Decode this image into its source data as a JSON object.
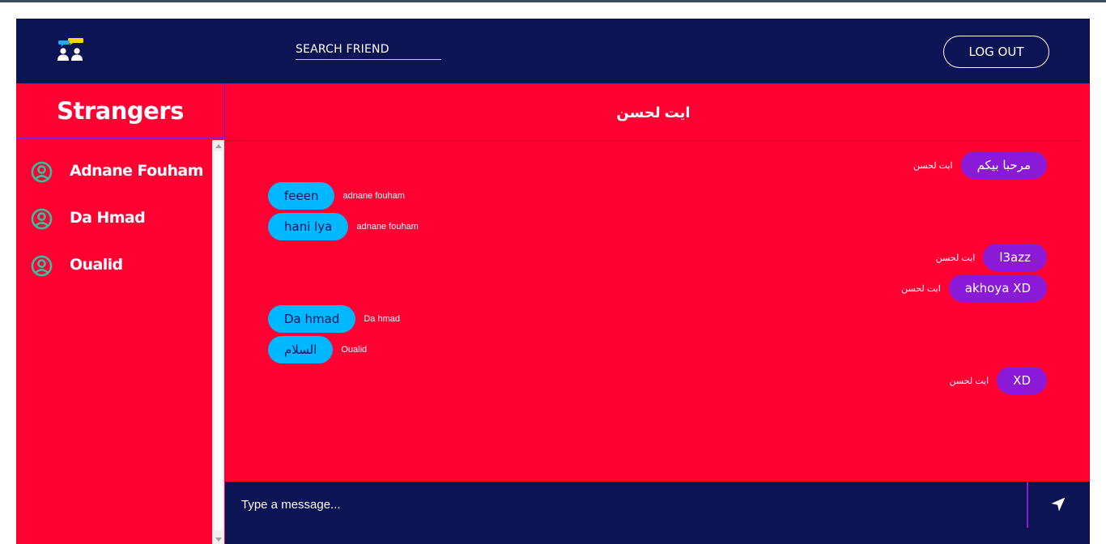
{
  "header": {
    "logo_icon": "chat-users-logo-icon",
    "search_label": "SEARCH FRIEND",
    "logout_label": "LOG OUT"
  },
  "sidebar": {
    "title": "Strangers",
    "friends": [
      {
        "name": "Adnane Fouham",
        "icon": "user-circle-icon"
      },
      {
        "name": "Da Hmad",
        "icon": "user-circle-icon"
      },
      {
        "name": "Oualid",
        "icon": "user-circle-icon"
      }
    ]
  },
  "chat": {
    "title": "ايت لحسن",
    "messages": [
      {
        "direction": "out",
        "text": "مرحبا بيكم",
        "sender": "ايت لحسن"
      },
      {
        "direction": "in",
        "text": "feeen",
        "sender": "adnane fouham"
      },
      {
        "direction": "in",
        "text": "hani lya",
        "sender": "adnane fouham"
      },
      {
        "direction": "out",
        "text": "l3azz",
        "sender": "ايت لحسن"
      },
      {
        "direction": "out",
        "text": "akhoya XD",
        "sender": "ايت لحسن"
      },
      {
        "direction": "in",
        "text": "Da hmad",
        "sender": "Da hmad"
      },
      {
        "direction": "in",
        "text": "السلام",
        "sender": "Oualid"
      },
      {
        "direction": "out",
        "text": "XD",
        "sender": "ايت لحسن"
      }
    ]
  },
  "composer": {
    "placeholder": "Type a message...",
    "send_icon": "send-arrow-icon"
  },
  "colors": {
    "navy": "#0d1454",
    "red": "#ff0033",
    "incoming_bubble": "#00b8ff",
    "outgoing_bubble": "#8b1ad8",
    "icon_teal": "#2ec4a0"
  }
}
